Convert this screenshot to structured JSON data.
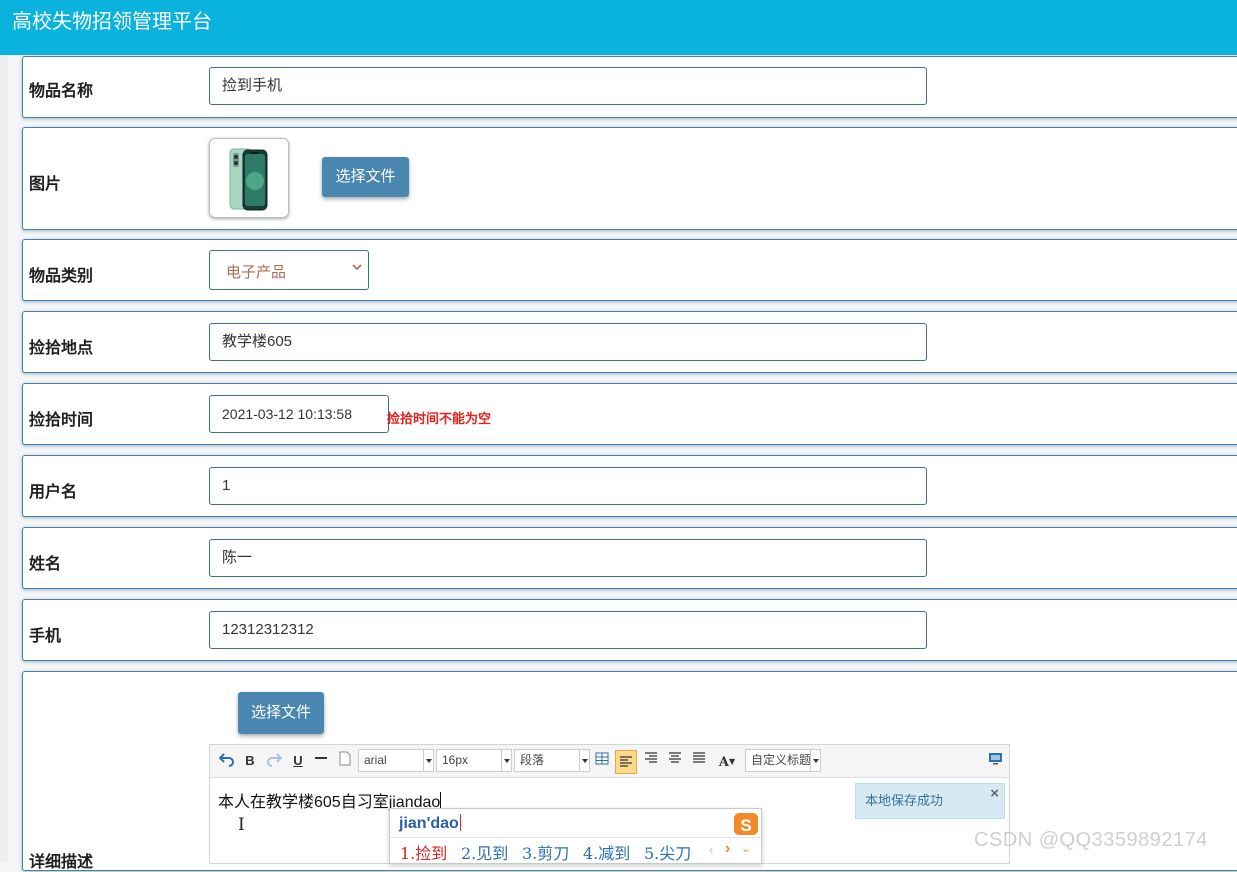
{
  "app": {
    "title": "高校失物招领管理平台"
  },
  "form": {
    "item_name": {
      "label": "物品名称",
      "value": "捡到手机"
    },
    "image": {
      "label": "图片",
      "button": "选择文件"
    },
    "category": {
      "label": "物品类别",
      "selected": "电子产品"
    },
    "location": {
      "label": "捡拾地点",
      "value": "教学楼605"
    },
    "time": {
      "label": "捡拾时间",
      "value": "2021-03-12 10:13:58",
      "error": "捡拾时间不能为空"
    },
    "username": {
      "label": "用户名",
      "value": "1"
    },
    "name": {
      "label": "姓名",
      "value": "陈一"
    },
    "phone": {
      "label": "手机",
      "value": "12312312312"
    },
    "description": {
      "label": "详细描述",
      "button": "选择文件",
      "toolbar": {
        "font_family": "arial",
        "font_size": "16px",
        "paragraph": "段落",
        "custom_title": "自定义标题",
        "font_color_glyph": "A"
      },
      "content": "本人在教学楼605自习室jiandao",
      "save_notice": "本地保存成功",
      "notice_close": "×"
    }
  },
  "ime": {
    "pinyin": "jian'dao",
    "candidates": [
      "1.捡到",
      "2.见到",
      "3.剪刀",
      "4.减到",
      "5.尖刀"
    ],
    "logo": "S"
  },
  "watermark": "CSDN @QQ3359892174",
  "colors": {
    "header": "#0ab3dd",
    "button": "#4a87b0",
    "error": "#e0211e",
    "border": "#3b6e99"
  }
}
